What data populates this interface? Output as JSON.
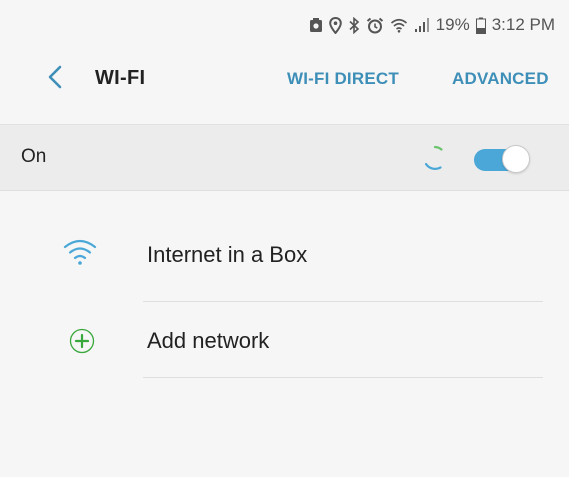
{
  "status_bar": {
    "icons": [
      "screenshot-icon",
      "location-icon",
      "bluetooth-icon",
      "alarm-icon",
      "wifi-status-icon",
      "signal-icon",
      "battery-icon"
    ],
    "battery": "19%",
    "time": "3:12 PM"
  },
  "app_bar": {
    "title": "WI-FI",
    "actions": [
      "WI-FI DIRECT",
      "ADVANCED"
    ]
  },
  "wifi_toggle": {
    "label": "On",
    "state": "on",
    "scanning": true
  },
  "networks": [
    {
      "label": "Internet in a Box",
      "icon": "wifi-icon"
    },
    {
      "label": "Add network",
      "icon": "plus-icon"
    }
  ],
  "colors": {
    "accent": "#3e8fb8",
    "switch_on": "#4aa7d7",
    "add_icon": "#39a83c",
    "background": "#f6f6f6",
    "toggle_row": "#ececec"
  }
}
